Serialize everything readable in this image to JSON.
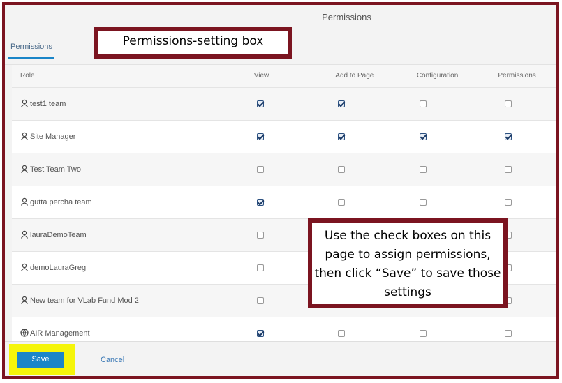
{
  "dialog": {
    "title": "Permissions"
  },
  "tabs": [
    {
      "label": "Permissions",
      "active": true
    }
  ],
  "table": {
    "headers": [
      "Role",
      "View",
      "Add to Page",
      "Configuration",
      "Permissions"
    ],
    "rows": [
      {
        "role": "test1 team",
        "icon": "user-icon",
        "view": true,
        "add_to_page": true,
        "configuration": false,
        "permissions": false
      },
      {
        "role": "Site Manager",
        "icon": "user-icon",
        "view": true,
        "add_to_page": true,
        "configuration": true,
        "permissions": true
      },
      {
        "role": "Test Team Two",
        "icon": "user-icon",
        "view": false,
        "add_to_page": false,
        "configuration": false,
        "permissions": false
      },
      {
        "role": "gutta percha team",
        "icon": "user-icon",
        "view": true,
        "add_to_page": false,
        "configuration": false,
        "permissions": false
      },
      {
        "role": "lauraDemoTeam",
        "icon": "user-icon",
        "view": false,
        "add_to_page": false,
        "configuration": false,
        "permissions": false
      },
      {
        "role": "demoLauraGreg",
        "icon": "user-icon",
        "view": false,
        "add_to_page": false,
        "configuration": false,
        "permissions": false
      },
      {
        "role": "New team for VLab Fund Mod 2",
        "icon": "user-icon",
        "view": false,
        "add_to_page": false,
        "configuration": false,
        "permissions": false
      },
      {
        "role": "AIR Management",
        "icon": "globe-icon",
        "view": true,
        "add_to_page": false,
        "configuration": false,
        "permissions": false
      }
    ]
  },
  "footer": {
    "save_label": "Save",
    "cancel_label": "Cancel"
  },
  "callouts": {
    "top": "Permissions-setting box",
    "main": "Use the check boxes on this page to assign permissions, then click “Save” to save those settings"
  },
  "colors": {
    "frame": "#7b1420",
    "highlight": "#f5f50a",
    "primary": "#1a86c8"
  }
}
